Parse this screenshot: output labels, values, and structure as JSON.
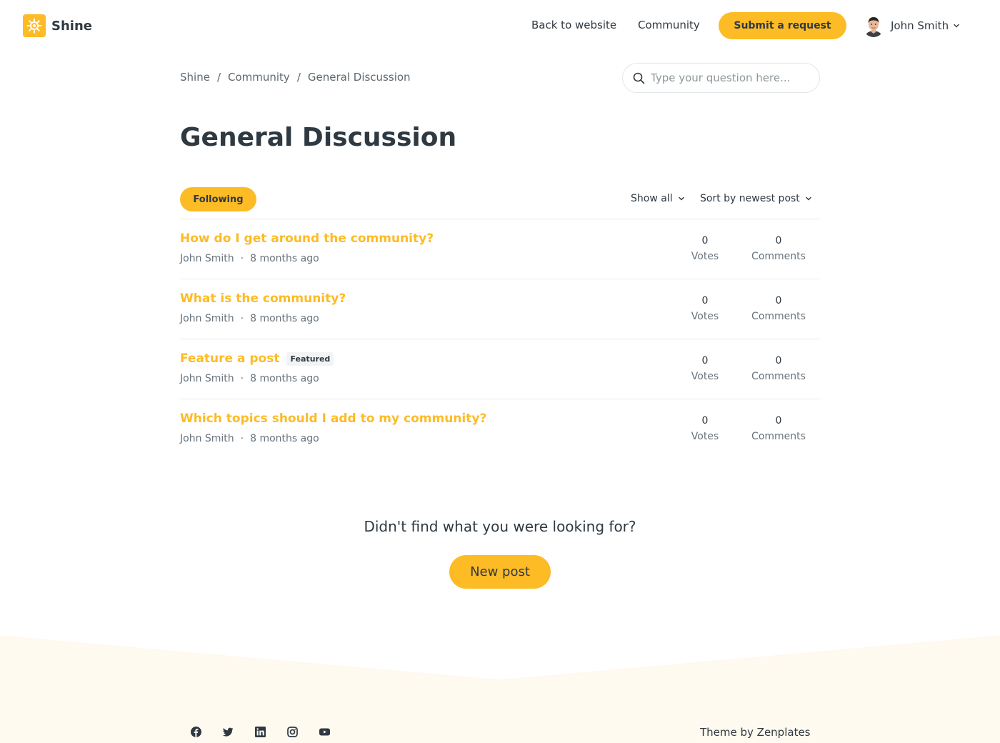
{
  "brand": {
    "name": "Shine",
    "accent": "#fdbb25"
  },
  "header": {
    "back_link": "Back to website",
    "community_link": "Community",
    "submit_button": "Submit a request",
    "user_name": "John Smith"
  },
  "breadcrumb": [
    "Shine",
    "Community",
    "General Discussion"
  ],
  "search": {
    "placeholder": "Type your question here..."
  },
  "page_title": "General Discussion",
  "controls": {
    "following": "Following",
    "show_filter": "Show all",
    "sort_filter": "Sort by newest post"
  },
  "posts": [
    {
      "title": "How do I get around the community?",
      "author": "John Smith",
      "time": "8 months ago",
      "votes": "0",
      "votes_label": "Votes",
      "comments": "0",
      "comments_label": "Comments"
    },
    {
      "title": "What is the community?",
      "author": "John Smith",
      "time": "8 months ago",
      "votes": "0",
      "votes_label": "Votes",
      "comments": "0",
      "comments_label": "Comments"
    },
    {
      "title": "Feature a post",
      "badge": "Featured",
      "author": "John Smith",
      "time": "8 months ago",
      "votes": "0",
      "votes_label": "Votes",
      "comments": "0",
      "comments_label": "Comments"
    },
    {
      "title": "Which topics should I add to my community?",
      "author": "John Smith",
      "time": "8 months ago",
      "votes": "0",
      "votes_label": "Votes",
      "comments": "0",
      "comments_label": "Comments"
    }
  ],
  "meta_separator": "·",
  "cta": {
    "text": "Didn't find what you were looking for?",
    "button": "New post"
  },
  "footer": {
    "socials": [
      "facebook-icon",
      "twitter-icon",
      "linkedin-icon",
      "instagram-icon",
      "youtube-icon"
    ],
    "credit": "Theme by Zenplates"
  }
}
